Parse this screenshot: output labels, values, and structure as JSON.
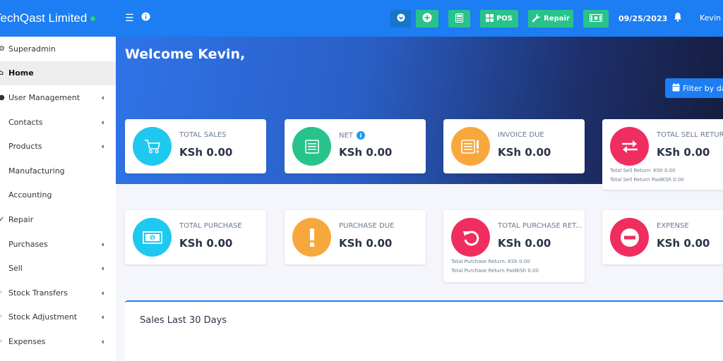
{
  "brand": {
    "title": "TechQast Limited",
    "status_color": "#2dd36f"
  },
  "topbar": {
    "buttons": [
      {
        "icon": "download-circle-icon",
        "label": "",
        "color": "#1676c8"
      },
      {
        "icon": "plus-circle-icon",
        "label": "",
        "color": "#27c38a"
      },
      {
        "icon": "calculator-icon",
        "label": "",
        "color": "#27c38a"
      },
      {
        "icon": "grid-icon",
        "label": "POS",
        "color": "#27c38a"
      },
      {
        "icon": "wrench-icon",
        "label": "Repair",
        "color": "#27c38a"
      },
      {
        "icon": "money-icon",
        "label": "",
        "color": "#27c38a"
      }
    ],
    "date": "09/25/2023",
    "user": "Kevin A"
  },
  "sidebar": {
    "items": [
      {
        "label": "Superadmin",
        "icon": "gear-icon",
        "chevron": false,
        "active": false
      },
      {
        "label": "Home",
        "icon": "home-icon",
        "chevron": false,
        "active": true
      },
      {
        "label": "User Management",
        "icon": "users-icon",
        "chevron": true,
        "active": false
      },
      {
        "label": "Contacts",
        "icon": "contacts-icon",
        "chevron": true,
        "active": false
      },
      {
        "label": "Products",
        "icon": "products-icon",
        "chevron": true,
        "active": false
      },
      {
        "label": "Manufacturing",
        "icon": "industry-icon",
        "chevron": false,
        "active": false
      },
      {
        "label": "Accounting",
        "icon": "accounting-icon",
        "chevron": false,
        "active": false
      },
      {
        "label": "Repair",
        "icon": "wrench-icon",
        "chevron": false,
        "active": false
      },
      {
        "label": "Purchases",
        "icon": "purchases-icon",
        "chevron": true,
        "active": false
      },
      {
        "label": "Sell",
        "icon": "sell-icon",
        "chevron": true,
        "active": false
      },
      {
        "label": "Stock Transfers",
        "icon": "truck-icon",
        "chevron": true,
        "active": false
      },
      {
        "label": "Stock Adjustment",
        "icon": "database-icon",
        "chevron": true,
        "active": false
      },
      {
        "label": "Expenses",
        "icon": "expenses-icon",
        "chevron": true,
        "active": false
      }
    ]
  },
  "main": {
    "welcome": "Welcome Kevin,",
    "filter_label": "Filter by dat"
  },
  "cards_row1": [
    {
      "label": "TOTAL SALES",
      "value": "KSh 0.00",
      "icon": "cart-icon",
      "color": "#1fc8ef",
      "info": false,
      "subs": []
    },
    {
      "label": "NET",
      "value": "KSh 0.00",
      "icon": "list-icon",
      "color": "#27c38a",
      "info": true,
      "subs": []
    },
    {
      "label": "INVOICE DUE",
      "value": "KSh 0.00",
      "icon": "invoice-alert-icon",
      "color": "#f7a83d",
      "info": false,
      "subs": []
    },
    {
      "label": "TOTAL SELL RETURN",
      "value": "KSh 0.00",
      "icon": "exchange-icon",
      "color": "#f02d5f",
      "info": false,
      "subs": [
        "Total Sell Return: KSh 0.00",
        "Total Sell Return PaidKSh 0.00"
      ]
    }
  ],
  "cards_row2": [
    {
      "label": "TOTAL PURCHASE",
      "value": "KSh 0.00",
      "icon": "cash-icon",
      "color": "#1fc8ef",
      "info": false,
      "subs": []
    },
    {
      "label": "PURCHASE DUE",
      "value": "KSh 0.00",
      "icon": "exclamation-icon",
      "color": "#f7a83d",
      "info": false,
      "subs": []
    },
    {
      "label": "TOTAL PURCHASE RET...",
      "value": "KSh 0.00",
      "icon": "undo-icon",
      "color": "#f02d5f",
      "info": false,
      "subs": [
        "Total Purchase Return: KSh 0.00",
        "Total Purchase Return PaidKSh 0.00"
      ]
    },
    {
      "label": "EXPENSE",
      "value": "KSh 0.00",
      "icon": "minus-circle-icon",
      "color": "#f02d5f",
      "info": false,
      "subs": []
    }
  ],
  "sales_panel": {
    "title": "Sales Last 30 Days"
  }
}
